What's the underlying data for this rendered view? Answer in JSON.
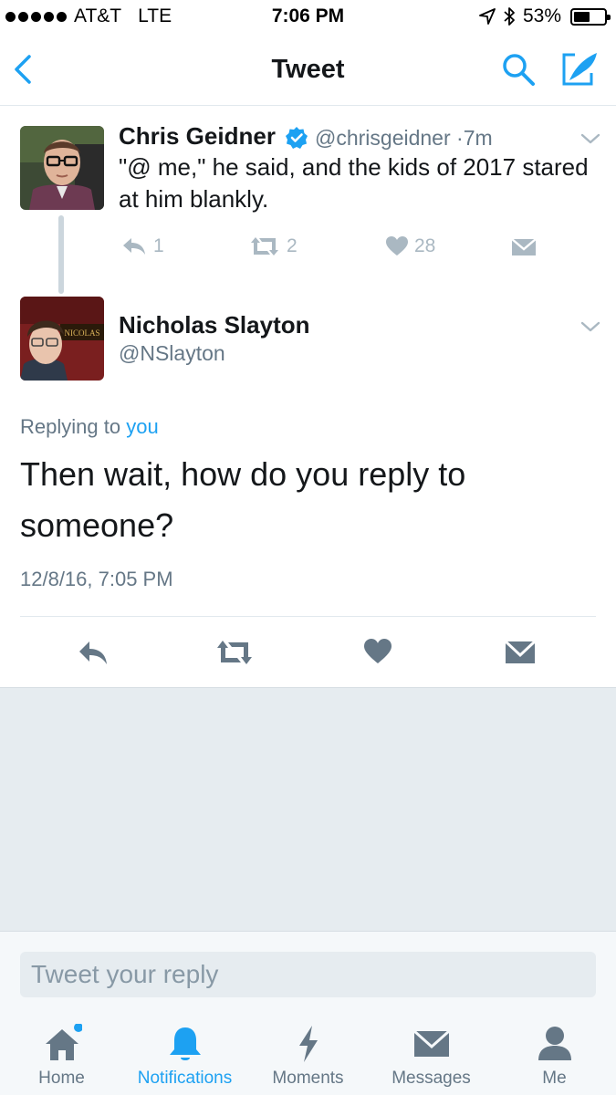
{
  "status_bar": {
    "carrier": "AT&T",
    "network": "LTE",
    "time": "7:06 PM",
    "battery": "53%",
    "battery_level": 0.53
  },
  "nav": {
    "title": "Tweet"
  },
  "parent_tweet": {
    "name": "Chris Geidner",
    "verified": true,
    "handle": "@chrisgeidner",
    "separator": "·",
    "time": "7m",
    "text": "\"@ me,\" he said, and the kids of 2017 stared at him blankly.",
    "reply_count": "1",
    "retweet_count": "2",
    "like_count": "28"
  },
  "main_tweet": {
    "name": "Nicholas Slayton",
    "handle": "@NSlayton",
    "avatar_sign": "NICOLAS",
    "replying_prefix": "Replying to",
    "replying_target": "you",
    "text": "Then wait, how do you reply to someone?",
    "timestamp": "12/8/16, 7:05 PM"
  },
  "reply_box": {
    "placeholder": "Tweet your reply"
  },
  "tabs": [
    {
      "label": "Home",
      "icon": "home-icon",
      "active": false
    },
    {
      "label": "Notifications",
      "icon": "bell-icon",
      "active": true
    },
    {
      "label": "Moments",
      "icon": "lightning-icon",
      "active": false
    },
    {
      "label": "Messages",
      "icon": "envelope-icon",
      "active": false
    },
    {
      "label": "Me",
      "icon": "person-icon",
      "active": false
    }
  ],
  "colors": {
    "accent": "#1da1f2",
    "muted": "#657786",
    "icon_gray": "#aab8c2",
    "icon_dark": "#657786",
    "background_gray": "#e6ecf0"
  }
}
